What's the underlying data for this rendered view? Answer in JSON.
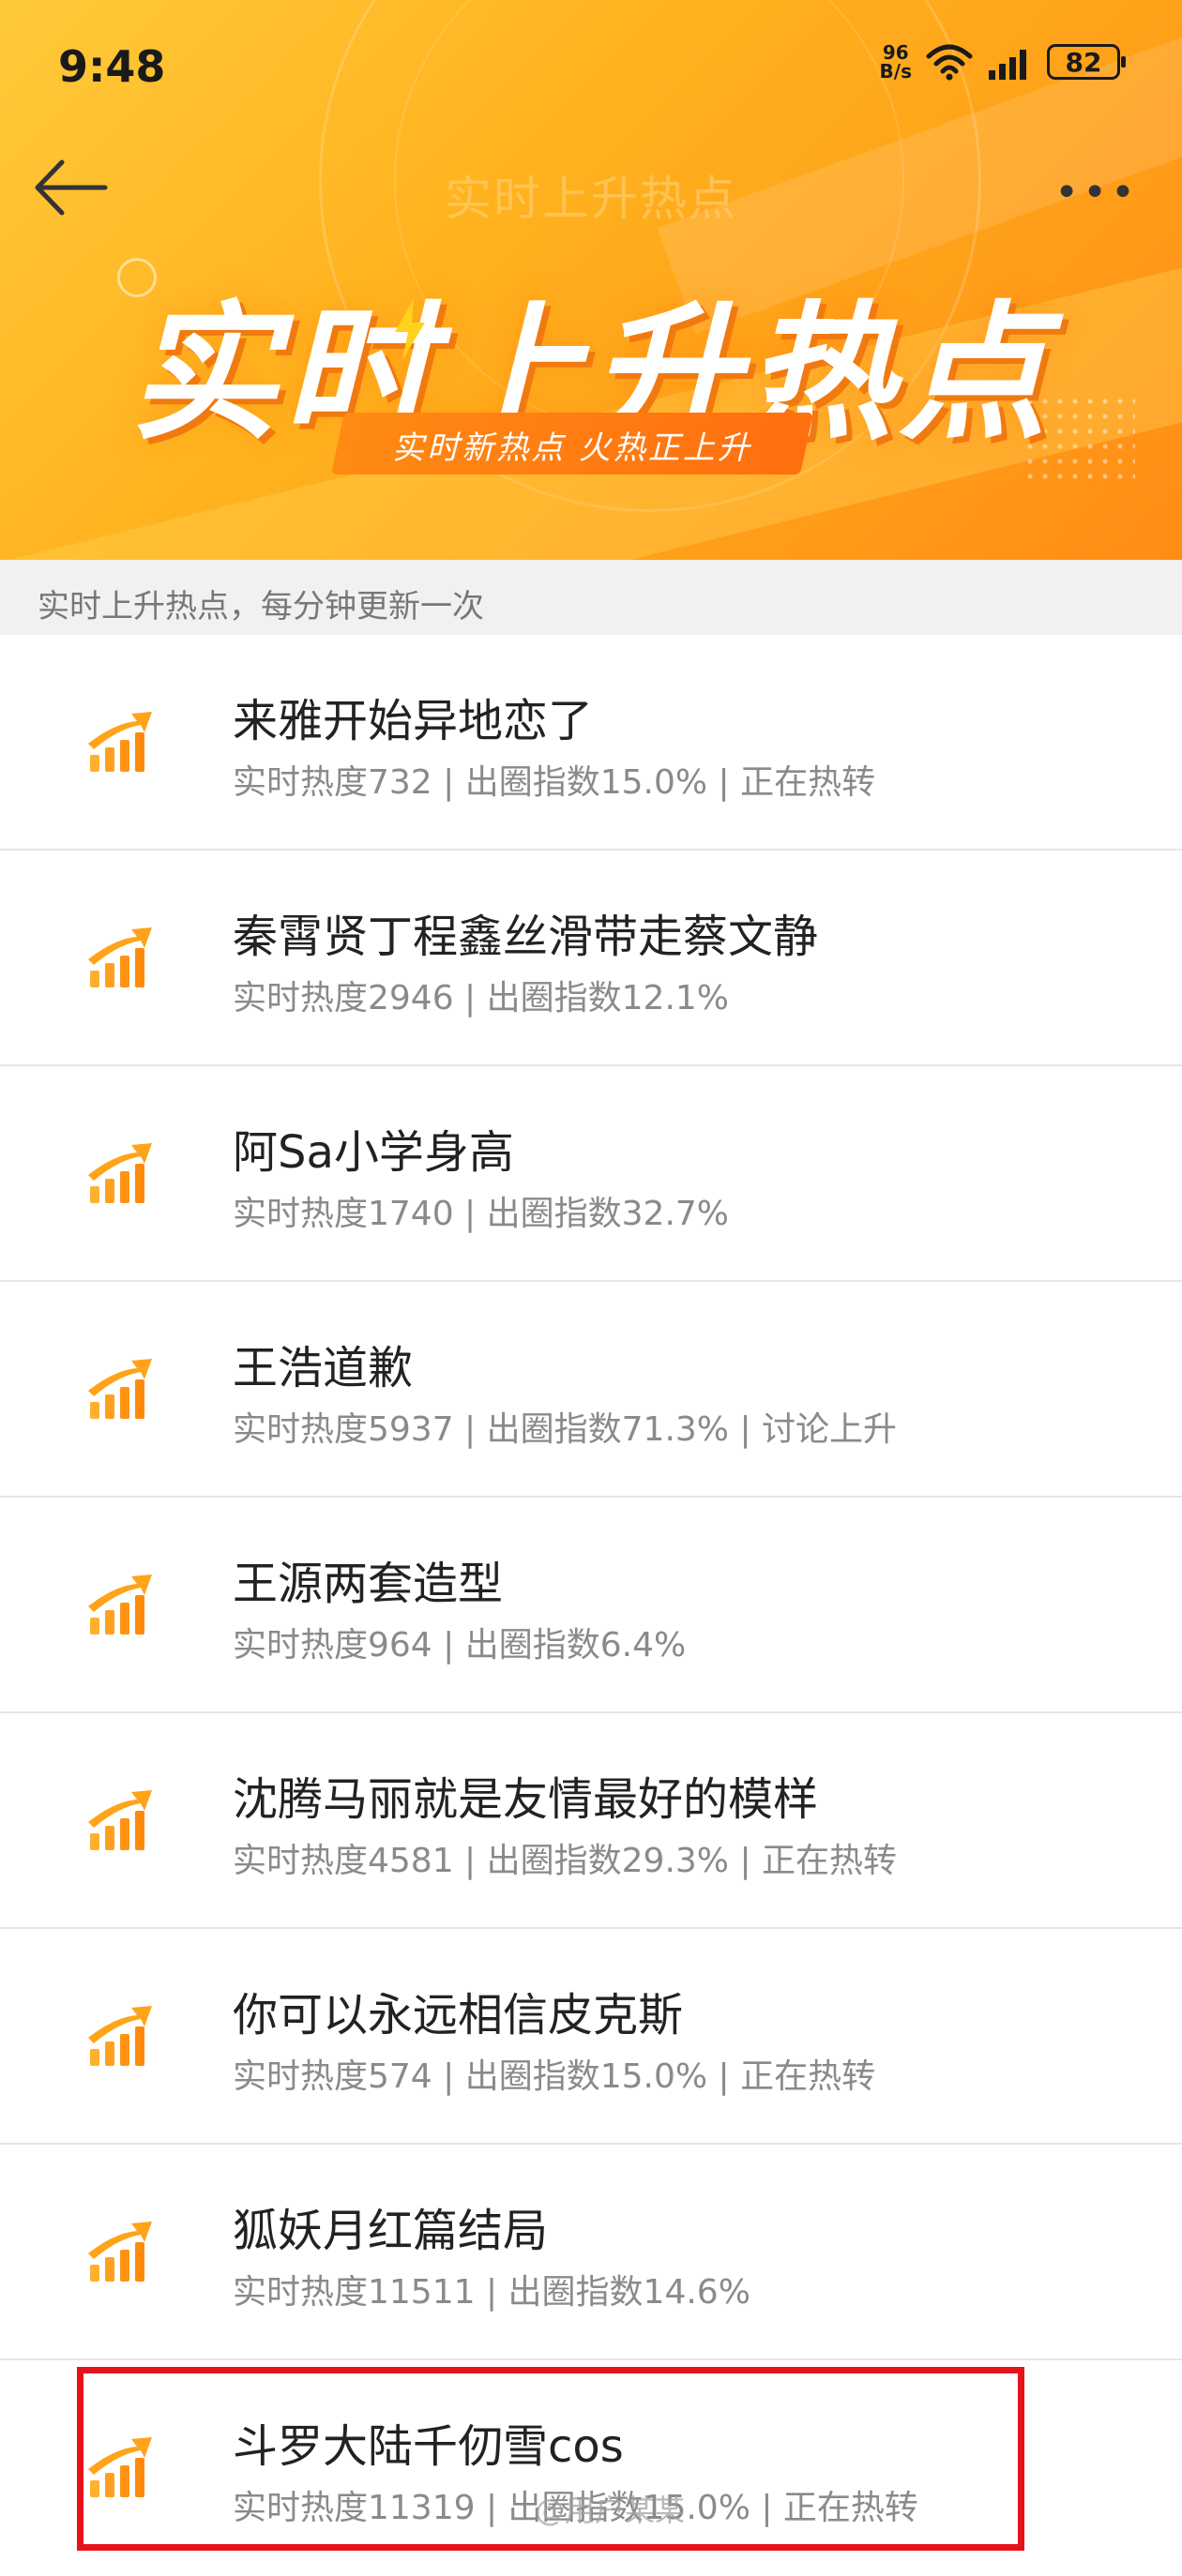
{
  "status": {
    "time": "9:48",
    "netspeed_value": "96",
    "netspeed_unit": "B/s",
    "battery": "82"
  },
  "nav": {
    "title": "实时上升热点"
  },
  "hero": {
    "title": "实时上升热点",
    "subtitle": "实时新热点 火热正上升"
  },
  "info": {
    "text": "实时上升热点，每分钟更新一次"
  },
  "items": [
    {
      "title": "来雅开始异地恋了",
      "meta": "实时热度732 | 出圈指数15.0% | 正在热转"
    },
    {
      "title": "秦霄贤丁程鑫丝滑带走蔡文静",
      "meta": "实时热度2946 | 出圈指数12.1%"
    },
    {
      "title": "阿Sa小学身高",
      "meta": "实时热度1740 | 出圈指数32.7%"
    },
    {
      "title": "王浩道歉",
      "meta": "实时热度5937 | 出圈指数71.3% | 讨论上升"
    },
    {
      "title": "王源两套造型",
      "meta": "实时热度964 | 出圈指数6.4%"
    },
    {
      "title": "沈腾马丽就是友情最好的模样",
      "meta": "实时热度4581 | 出圈指数29.3% | 正在热转"
    },
    {
      "title": "你可以永远相信皮克斯",
      "meta": "实时热度574 | 出圈指数15.0% | 正在热转"
    },
    {
      "title": "狐妖月红篇结局",
      "meta": "实时热度11511 | 出圈指数14.6%"
    },
    {
      "title": "斗罗大陆千仞雪cos",
      "meta": "实时热度11319 | 出圈指数15.0% | 正在热转"
    }
  ],
  "watermark": "@用户某某",
  "colors": {
    "accent": "#ffa31a",
    "highlight": "#e8121b"
  }
}
